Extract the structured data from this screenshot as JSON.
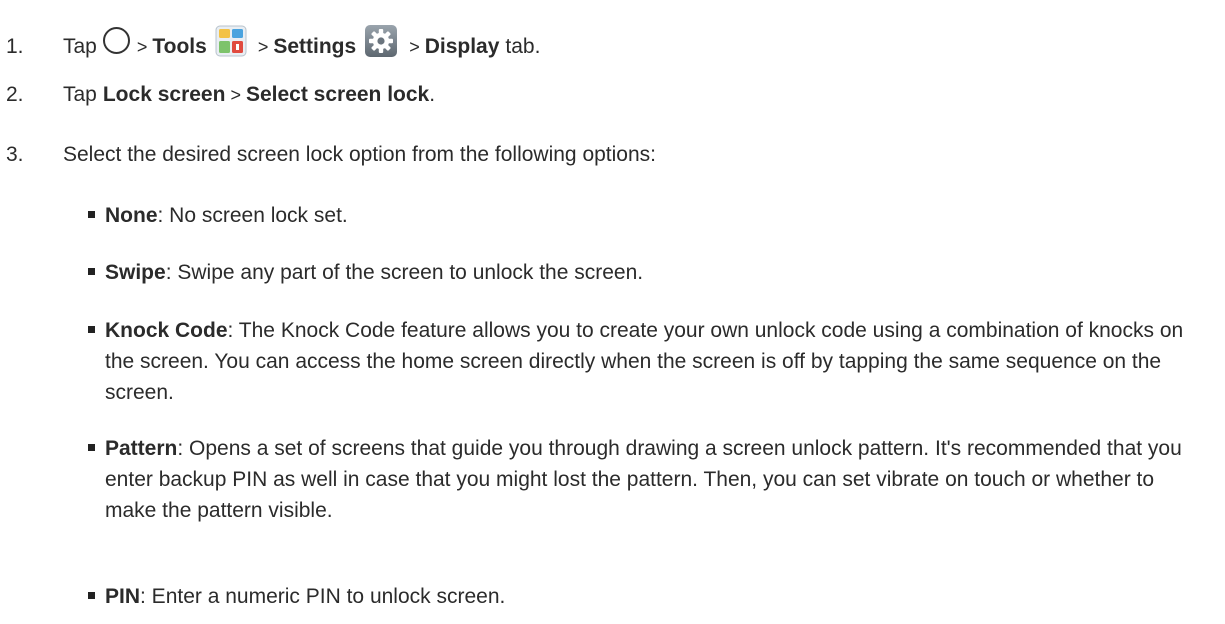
{
  "steps": [
    {
      "num": "1.",
      "pre": "Tap",
      "sep": ">",
      "tools": "Tools",
      "settings": "Settings",
      "display": "Display",
      "tail": "tab."
    },
    {
      "num": "2.",
      "pre": "Tap",
      "lock_screen": "Lock screen",
      "sep": ">",
      "select_lock": "Select screen lock",
      "tail": "."
    },
    {
      "num": "3.",
      "text": "Select the desired screen lock option from the following options:"
    }
  ],
  "options": [
    {
      "label": "None",
      "desc": ": No screen lock set."
    },
    {
      "label": "Swipe",
      "desc": ": Swipe any part of the screen to unlock the screen."
    },
    {
      "label": "Knock Code",
      "desc": ": The Knock Code feature allows you to create your own unlock code using a combination of knocks on the screen. You can access the home screen directly when the screen is off by tapping the same sequence on the screen."
    },
    {
      "label": "Pattern",
      "desc": ": Opens a set of screens that guide you through drawing a screen unlock pattern. It's recommended that you enter backup PIN as well in case that you might lost the pattern. Then, you can set vibrate on touch or whether to make the pattern visible."
    },
    {
      "label": "PIN",
      "desc": ": Enter a numeric PIN to unlock screen."
    }
  ],
  "icons": {
    "home": "home-circle-icon",
    "tools": "tools-folder-icon",
    "settings": "settings-gear-icon"
  }
}
